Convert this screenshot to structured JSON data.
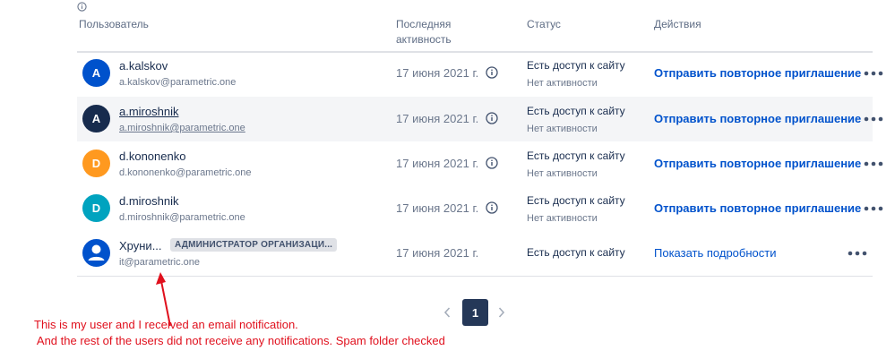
{
  "header": {
    "user": "Пользователь",
    "last_activity": "Последняя активность",
    "status": "Статус",
    "actions": "Действия"
  },
  "users": [
    {
      "initial": "A",
      "name": "a.kalskov",
      "email": "a.kalskov@parametric.one",
      "avatar_color": "#0052cc",
      "date": "17 июня 2021 г.",
      "status": "Есть доступ к сайту",
      "status_sub": "Нет активности",
      "action": "Отправить повторное приглашение"
    },
    {
      "initial": "A",
      "name": "a.miroshnik",
      "email": "a.miroshnik@parametric.one",
      "avatar_color": "#172b4d",
      "date": "17 июня 2021 г.",
      "status": "Есть доступ к сайту",
      "status_sub": "Нет активности",
      "action": "Отправить повторное приглашение"
    },
    {
      "initial": "D",
      "name": "d.kononenko",
      "email": "d.kononenko@parametric.one",
      "avatar_color": "#ff991f",
      "date": "17 июня 2021 г.",
      "status": "Есть доступ к сайту",
      "status_sub": "Нет активности",
      "action": "Отправить повторное приглашение"
    },
    {
      "initial": "D",
      "name": "d.miroshnik",
      "email": "d.miroshnik@parametric.one",
      "avatar_color": "#00a3bf",
      "date": "17 июня 2021 г.",
      "status": "Есть доступ к сайту",
      "status_sub": "Нет активности",
      "action": "Отправить повторное приглашение"
    },
    {
      "initial": "",
      "name": "Хруни...",
      "badge": "АДМИНИСТРАТОР ОРГАНИЗАЦИ...",
      "email": "it@parametric.one",
      "avatar_color": "#0052cc",
      "date": "17 июня 2021 г.",
      "status": "Есть доступ к сайту",
      "status_sub": "",
      "action": "Показать подробности"
    }
  ],
  "pagination": {
    "current_page": "1"
  },
  "annotation": {
    "line1": "This is my user and I received an email notification.",
    "line2": " And the rest of the users did not receive any notifications. Spam folder checked"
  },
  "colors": {
    "accent": "#0052cc",
    "annotation": "#e0101d",
    "pager": "#253858"
  }
}
